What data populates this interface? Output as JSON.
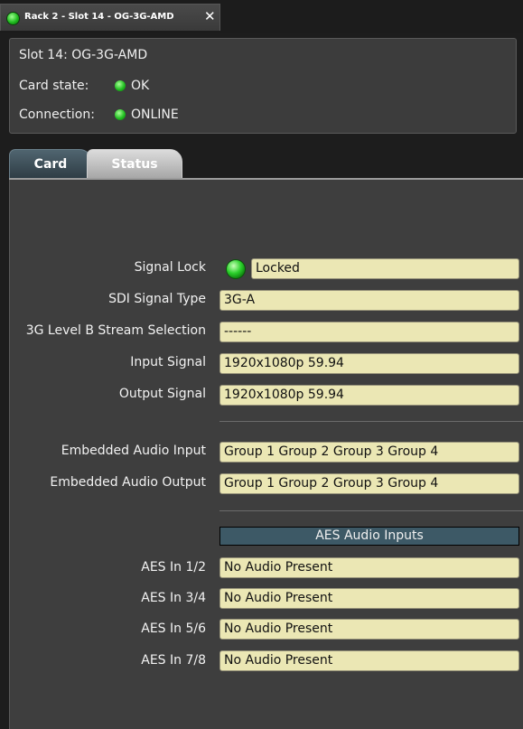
{
  "window_tab": {
    "title": "Rack 2 - Slot 14 - OG-3G-AMD",
    "close_glyph": "✕"
  },
  "header": {
    "slot_line": "Slot 14: OG-3G-AMD",
    "card_state_label": "Card state:",
    "card_state_value": "OK",
    "connection_label": "Connection:",
    "connection_value": "ONLINE",
    "status_color": "#22c022"
  },
  "tabs": [
    {
      "label": "Card",
      "selected": false
    },
    {
      "label": "Status",
      "selected": true
    }
  ],
  "status": {
    "signal_lock": {
      "label": "Signal Lock",
      "value": "Locked"
    },
    "sdi_signal_type": {
      "label": "SDI Signal Type",
      "value": "3G-A"
    },
    "level_b_stream": {
      "label": "3G Level B Stream Selection",
      "value": "------"
    },
    "input_signal": {
      "label": "Input Signal",
      "value": "1920x1080p 59.94"
    },
    "output_signal": {
      "label": "Output Signal",
      "value": "1920x1080p 59.94"
    },
    "embedded_audio_input": {
      "label": "Embedded Audio Input",
      "value": "Group 1 Group 2 Group 3 Group 4"
    },
    "embedded_audio_output": {
      "label": "Embedded Audio Output",
      "value": "Group 1 Group 2 Group 3 Group 4"
    }
  },
  "aes": {
    "header": "AES Audio Inputs",
    "inputs": [
      {
        "label": "AES In 1/2",
        "value": "No Audio Present"
      },
      {
        "label": "AES In 3/4",
        "value": "No Audio Present"
      },
      {
        "label": "AES In 5/6",
        "value": "No Audio Present"
      },
      {
        "label": "AES In 7/8",
        "value": "No Audio Present"
      }
    ]
  },
  "colors": {
    "field_bg": "#ebe7b4",
    "aes_header_bg": "#3d5966",
    "led_green": "#2bd02b"
  }
}
